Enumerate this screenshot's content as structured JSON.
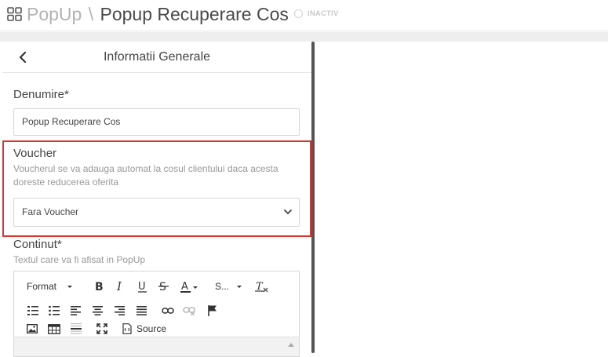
{
  "header": {
    "section": "PopUp",
    "separator": "\\",
    "title": "Popup Recuperare Cos",
    "status": "INACTIV",
    "icon": "grid-icon"
  },
  "panel": {
    "title": "Informatii Generale",
    "back_icon": "chevron-left-icon"
  },
  "form": {
    "name_label": "Denumire*",
    "name_value": "Popup Recuperare Cos",
    "voucher_label": "Voucher",
    "voucher_hint": "Voucherul se va adauga automat la cosul clientului daca acesta doreste reducerea oferita",
    "voucher_selected": "Fara Voucher",
    "content_label": "Continut*",
    "content_hint": "Textul care va fi afisat in PopUp"
  },
  "editor_toolbar": {
    "format_label": "Format",
    "style_label": "S...",
    "source_label": "Source"
  },
  "colors": {
    "highlight_border": "#d9332b",
    "scrollbar": "#555555"
  }
}
